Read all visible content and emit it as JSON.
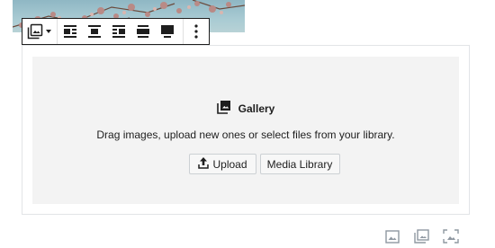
{
  "toolbar": {
    "buttons": [
      {
        "name": "change-block-type",
        "icon": "gallery-icon"
      },
      {
        "name": "align-left",
        "icon": "align-left-icon"
      },
      {
        "name": "align-center",
        "icon": "align-center-icon"
      },
      {
        "name": "align-right",
        "icon": "align-right-icon"
      },
      {
        "name": "align-wide",
        "icon": "align-wide-icon"
      },
      {
        "name": "align-full",
        "icon": "align-full-icon"
      },
      {
        "name": "more-options",
        "icon": "vertical-ellipsis-icon"
      }
    ]
  },
  "gallery": {
    "title": "Gallery",
    "instructions": "Drag images, upload new ones or select files from your library.",
    "upload_label": "Upload",
    "media_library_label": "Media Library"
  },
  "inserter": {
    "icons": [
      "image-icon",
      "gallery-icon",
      "cover-icon"
    ]
  },
  "colors": {
    "toolbar_border": "#1e1e1e",
    "placeholder_bg": "#f3f3f3",
    "frame_border": "#e2e4e7"
  }
}
